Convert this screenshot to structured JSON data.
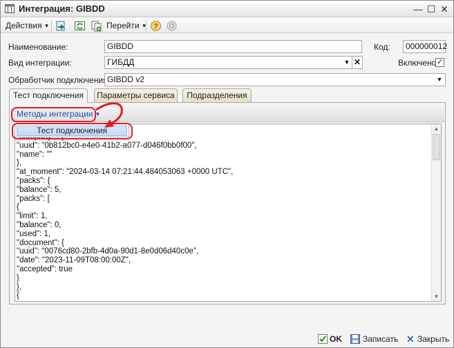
{
  "window": {
    "title": "Интеграция: GIBDD",
    "controls": {
      "minimize": "—",
      "maximize": "☐",
      "close": "✕"
    }
  },
  "toolbar": {
    "actions_label": "Действия",
    "goto_label": "Перейти",
    "icons": [
      "post-and-close-icon",
      "refresh-icon",
      "copy-icon",
      "help-icon",
      "settings-icon"
    ]
  },
  "form": {
    "name_label": "Наименование:",
    "name_value": "GIBDD",
    "code_label": "Код:",
    "code_value": "000000012",
    "type_label": "Вид интеграции:",
    "type_value": "ГИБДД",
    "enabled_label": "Включено",
    "enabled_checked": true,
    "handler_label": "Обработчик подключения:",
    "handler_value": "GIBDD v2"
  },
  "tabs": [
    {
      "label": "Тест подключения",
      "active": true
    },
    {
      "label": "Параметры сервиса",
      "active": false
    },
    {
      "label": "Подразделения",
      "active": false
    }
  ],
  "panel": {
    "methods_label": "Методы интеграции",
    "dropdown_item": "Тест подключения"
  },
  "output_lines": [
    "\"company\" : {",
    "\"uuid\": \"0b812bc0-e4e0-41b2-a077-d046f0bb0f00\",",
    "\"name\": \"\"",
    "},",
    "\"at_moment\": \"2024-03-14 07:21:44.484053063 +0000 UTC\",",
    "\"packs\": {",
    "\"balance\": 5,",
    "\"packs\": [",
    "{",
    "\"limit\": 1,",
    "\"balance\": 0,",
    "\"used\": 1,",
    "\"document\": {",
    "\"uuid\": \"0076cd80-2bfb-4d0a-90d1-8e0d06d40c0e\",",
    "\"date\": \"2023-11-09T08:00:00Z\",",
    "\"accepted\": true",
    "}",
    "},",
    "{"
  ],
  "footer": {
    "ok_label": "OK",
    "save_label": "Записать",
    "close_label": "Закрыть"
  },
  "colors": {
    "annotation_red": "#e01b24",
    "link_blue": "#1a4bb3"
  }
}
